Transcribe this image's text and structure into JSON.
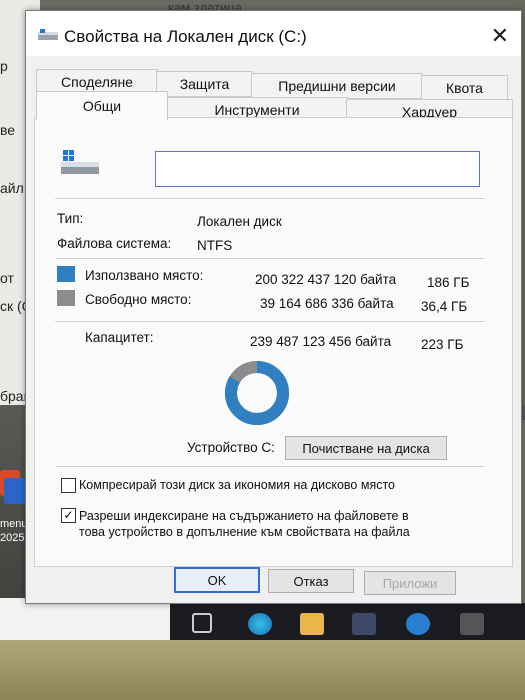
{
  "background": {
    "top_text": "кам златица",
    "left_fragments": [
      "р",
      "ве",
      "айл",
      "от",
      "ск (С",
      "бран"
    ],
    "desktop_fragments": [
      "menu",
      "2025."
    ]
  },
  "dialog": {
    "title": "Свойства на Локален диск (C:)",
    "close_glyph": "✕",
    "tabs_row1": [
      "Споделяне",
      "Защита",
      "Предишни версии",
      "Квота"
    ],
    "tabs_row2": [
      "Общи",
      "Инструменти",
      "Хардуер"
    ],
    "active_tab": "Общи",
    "general": {
      "name_value": "",
      "type_label": "Тип:",
      "type_value": "Локален диск",
      "fs_label": "Файлова система:",
      "fs_value": "NTFS",
      "used_label": "Използвано място:",
      "used_bytes": "200 322 437 120 байта",
      "used_gb": "186 ГБ",
      "free_label": "Свободно място:",
      "free_bytes": "39 164 686 336 байта",
      "free_gb": "36,4 ГБ",
      "capacity_label": "Капацитет:",
      "capacity_bytes": "239 487 123 456 байта",
      "capacity_gb": "223 ГБ",
      "used_fraction": 0.836,
      "drive_label": "Устройство C:",
      "cleanup_button": "Почистване на диска",
      "compress_label": "Компресирай този диск за икономия на дисково място",
      "compress_checked": false,
      "index_label_line1": "Разреши индексиране на съдържанието на файловете в",
      "index_label_line2": "това устройство в допълнение към свойствата на файла",
      "index_checked": true
    },
    "buttons": {
      "ok": "OK",
      "cancel": "Отказ",
      "apply": "Приложи"
    }
  },
  "colors": {
    "used": "#2f7fc1",
    "free": "#8c8c8c",
    "accent": "#2d6fd3"
  },
  "icons": [
    "drive-icon",
    "close-icon",
    "checkbox-check-icon"
  ]
}
